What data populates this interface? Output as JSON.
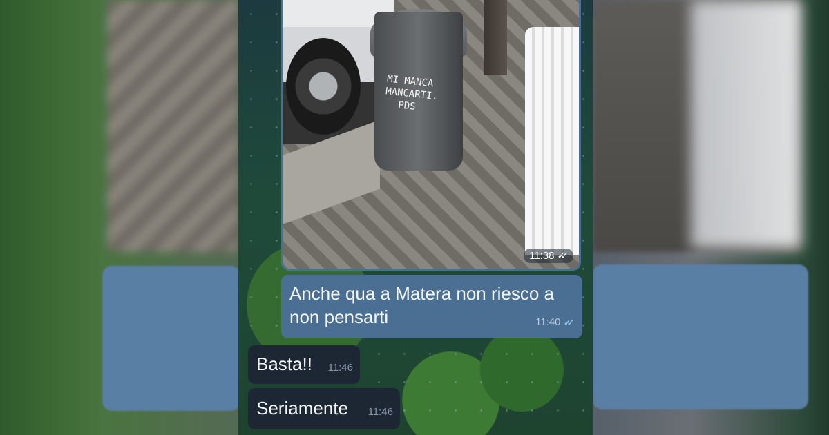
{
  "photo_message": {
    "bin_writing": [
      "MI MANCA",
      "MANCARTI.",
      "PDS"
    ],
    "time": "11:38",
    "status_icon": "double-check-icon"
  },
  "messages": [
    {
      "direction": "outgoing",
      "text": "Anche qua a Matera non riesco a non pensarti",
      "time": "11:40",
      "status_icon": "double-check-icon"
    },
    {
      "direction": "incoming",
      "text": "Basta!!",
      "time": "11:46"
    },
    {
      "direction": "incoming",
      "text": "Seriamente",
      "time": "11:46"
    }
  ],
  "colors": {
    "outgoing_bubble": "#4b6e93",
    "incoming_bubble": "#1d2733",
    "read_ticks": "#9fd0ff"
  }
}
